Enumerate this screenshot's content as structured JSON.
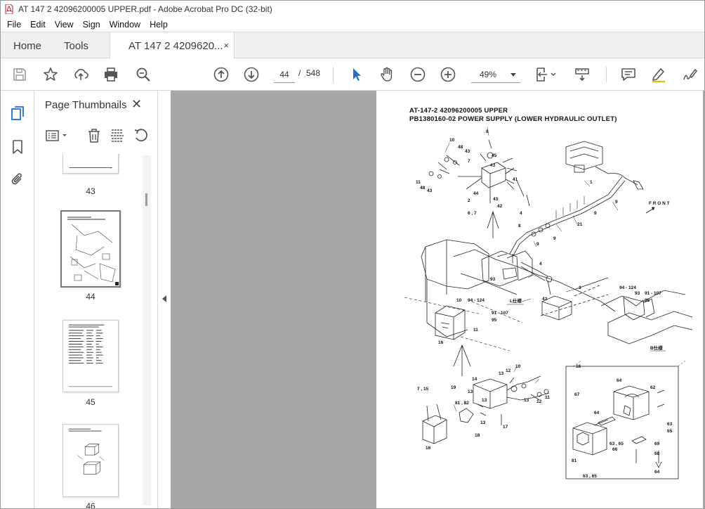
{
  "window": {
    "title": "AT 147 2 42096200005 UPPER.pdf - Adobe Acrobat Pro DC (32-bit)"
  },
  "menu": [
    "File",
    "Edit",
    "View",
    "Sign",
    "Window",
    "Help"
  ],
  "tabs": {
    "home": "Home",
    "tools": "Tools",
    "document": "AT 147 2 4209620...",
    "close_symbol": "×"
  },
  "toolbar": {
    "current_page": "44",
    "page_separator": "/",
    "total_pages": "548",
    "zoom": "49%",
    "icons": [
      "save-icon",
      "bookmark-star-icon",
      "share-upload-icon",
      "print-icon",
      "search-zoom-icon",
      "page-up-icon",
      "page-down-icon",
      "select-cursor-icon",
      "hand-icon",
      "zoom-out-icon",
      "zoom-in-icon",
      "fit-page-icon",
      "scroll-mode-icon",
      "comment-icon",
      "highlight-pen-icon",
      "sign-icon"
    ]
  },
  "sidebar": {
    "panel_title": "Page Thumbnails",
    "close_symbol": "✕",
    "thumbnails": [
      {
        "label": "43"
      },
      {
        "label": "44",
        "selected": true
      },
      {
        "label": "45"
      },
      {
        "label": "46"
      }
    ]
  },
  "page": {
    "heading_line1": "AT-147-2 42096200005 UPPER",
    "heading_line2": "PB1380160-02 POWER SUPPLY (LOWER HYDRAULIC OUTLET)",
    "front_label": "F R O N T",
    "callouts": [
      "10",
      "48",
      "43",
      "7",
      "8",
      "45",
      "43",
      "11",
      "48",
      "43",
      "41",
      "44",
      "43",
      "2",
      "42",
      "6 , 7",
      "4",
      "1",
      "9",
      "9",
      "21",
      "8",
      "9",
      "9",
      "4",
      "93",
      "3",
      "43",
      "10",
      "94 - 124",
      "91 - 107",
      "95",
      "11",
      "16",
      "L仕様",
      "94 - 124",
      "93",
      "91 - 107",
      "95",
      "B仕様",
      "14",
      "10",
      "13",
      "12",
      "13",
      "19",
      "81 , 82",
      "13",
      "13",
      "12",
      "11",
      "7 , 15",
      "18",
      "13",
      "17",
      "16",
      "16",
      "64",
      "62",
      "67",
      "64",
      "63",
      "65",
      "81",
      "66",
      "69",
      "63 , 65",
      "68",
      "64",
      "63 , 65"
    ]
  }
}
